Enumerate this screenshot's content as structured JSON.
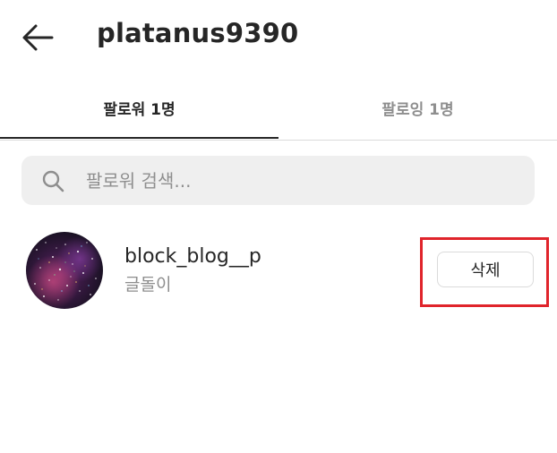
{
  "header": {
    "back_icon": "arrow-left-icon",
    "username": "platanus9390"
  },
  "tabs": [
    {
      "label": "팔로워 1명",
      "active": true
    },
    {
      "label": "팔로잉 1명",
      "active": false
    }
  ],
  "search": {
    "icon": "search-icon",
    "placeholder": "팔로워 검색..."
  },
  "followers": [
    {
      "username": "block_blog__p",
      "full_name": "글돌이",
      "action_label": "삭제",
      "highlighted": true
    }
  ],
  "colors": {
    "text_primary": "#262626",
    "text_secondary": "#8e8e8e",
    "search_bg": "#efefef",
    "divider": "#dbdbdb",
    "highlight": "#e0242b"
  }
}
